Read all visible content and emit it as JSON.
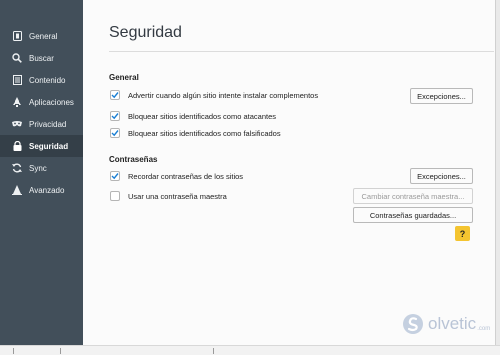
{
  "sidebar": {
    "items": [
      {
        "label": "General",
        "icon": "general-icon"
      },
      {
        "label": "Buscar",
        "icon": "search-icon"
      },
      {
        "label": "Contenido",
        "icon": "content-icon"
      },
      {
        "label": "Aplicaciones",
        "icon": "rocket-icon"
      },
      {
        "label": "Privacidad",
        "icon": "mask-icon"
      },
      {
        "label": "Seguridad",
        "icon": "lock-icon",
        "active": true
      },
      {
        "label": "Sync",
        "icon": "sync-icon"
      },
      {
        "label": "Avanzado",
        "icon": "wizard-icon"
      }
    ]
  },
  "page": {
    "title": "Seguridad"
  },
  "general": {
    "heading": "General",
    "warn_addons": {
      "label": "Advertir cuando algún sitio intente instalar complementos",
      "checked": true
    },
    "block_attack": {
      "label": "Bloquear sitios identificados como atacantes",
      "checked": true
    },
    "block_forgery": {
      "label": "Bloquear sitios identificados como falsificados",
      "checked": true
    },
    "exceptions_label": "Excepciones..."
  },
  "passwords": {
    "heading": "Contraseñas",
    "remember": {
      "label": "Recordar contraseñas de los sitios",
      "checked": true
    },
    "master": {
      "label": "Usar una contraseña maestra",
      "checked": false
    },
    "exceptions_label": "Excepciones...",
    "change_master_label": "Cambiar contraseña maestra...",
    "saved_label": "Contraseñas guardadas..."
  },
  "help": {
    "label": "?"
  },
  "watermark": {
    "text": "olvetic",
    "suffix": ".com"
  },
  "colors": {
    "sidebar": "#424f5a",
    "sidebar_active": "#343f48",
    "check": "#1a7fd4",
    "help": "#f4c430"
  }
}
